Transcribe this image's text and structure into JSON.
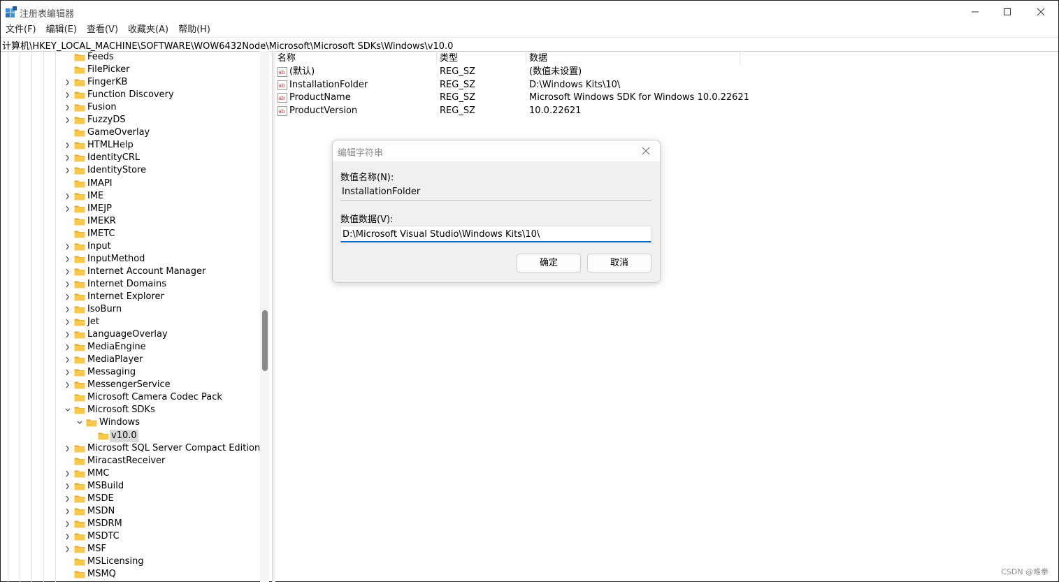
{
  "window": {
    "title": "注册表编辑器"
  },
  "menu": [
    "文件(F)",
    "编辑(E)",
    "查看(V)",
    "收藏夹(A)",
    "帮助(H)"
  ],
  "address": "计算机\\HKEY_LOCAL_MACHINE\\SOFTWARE\\WOW6432Node\\Microsoft\\Microsoft SDKs\\Windows\\v10.0",
  "tree": {
    "items": [
      {
        "label": "Feeds",
        "expander": "none",
        "level": 1
      },
      {
        "label": "FilePicker",
        "expander": "none",
        "level": 1
      },
      {
        "label": "FingerKB",
        "expander": "collapsed",
        "level": 1
      },
      {
        "label": "Function Discovery",
        "expander": "collapsed",
        "level": 1
      },
      {
        "label": "Fusion",
        "expander": "collapsed",
        "level": 1
      },
      {
        "label": "FuzzyDS",
        "expander": "collapsed",
        "level": 1
      },
      {
        "label": "GameOverlay",
        "expander": "none",
        "level": 1
      },
      {
        "label": "HTMLHelp",
        "expander": "collapsed",
        "level": 1
      },
      {
        "label": "IdentityCRL",
        "expander": "collapsed",
        "level": 1
      },
      {
        "label": "IdentityStore",
        "expander": "collapsed",
        "level": 1
      },
      {
        "label": "IMAPI",
        "expander": "none",
        "level": 1
      },
      {
        "label": "IME",
        "expander": "collapsed",
        "level": 1
      },
      {
        "label": "IMEJP",
        "expander": "collapsed",
        "level": 1
      },
      {
        "label": "IMEKR",
        "expander": "none",
        "level": 1
      },
      {
        "label": "IMETC",
        "expander": "none",
        "level": 1
      },
      {
        "label": "Input",
        "expander": "collapsed",
        "level": 1
      },
      {
        "label": "InputMethod",
        "expander": "collapsed",
        "level": 1
      },
      {
        "label": "Internet Account Manager",
        "expander": "collapsed",
        "level": 1
      },
      {
        "label": "Internet Domains",
        "expander": "collapsed",
        "level": 1
      },
      {
        "label": "Internet Explorer",
        "expander": "collapsed",
        "level": 1
      },
      {
        "label": "IsoBurn",
        "expander": "collapsed",
        "level": 1
      },
      {
        "label": "Jet",
        "expander": "collapsed",
        "level": 1
      },
      {
        "label": "LanguageOverlay",
        "expander": "collapsed",
        "level": 1
      },
      {
        "label": "MediaEngine",
        "expander": "collapsed",
        "level": 1
      },
      {
        "label": "MediaPlayer",
        "expander": "collapsed",
        "level": 1
      },
      {
        "label": "Messaging",
        "expander": "collapsed",
        "level": 1
      },
      {
        "label": "MessengerService",
        "expander": "collapsed",
        "level": 1
      },
      {
        "label": "Microsoft Camera Codec Pack",
        "expander": "none",
        "level": 1
      },
      {
        "label": "Microsoft SDKs",
        "expander": "expanded",
        "level": 1
      },
      {
        "label": "Windows",
        "expander": "expanded",
        "level": 2
      },
      {
        "label": "v10.0",
        "expander": "none",
        "level": 3,
        "selected": true
      },
      {
        "label": "Microsoft SQL Server Compact Edition",
        "expander": "collapsed",
        "level": 1
      },
      {
        "label": "MiracastReceiver",
        "expander": "none",
        "level": 1
      },
      {
        "label": "MMC",
        "expander": "collapsed",
        "level": 1
      },
      {
        "label": "MSBuild",
        "expander": "collapsed",
        "level": 1
      },
      {
        "label": "MSDE",
        "expander": "collapsed",
        "level": 1
      },
      {
        "label": "MSDN",
        "expander": "collapsed",
        "level": 1
      },
      {
        "label": "MSDRM",
        "expander": "collapsed",
        "level": 1
      },
      {
        "label": "MSDTC",
        "expander": "collapsed",
        "level": 1
      },
      {
        "label": "MSF",
        "expander": "collapsed",
        "level": 1
      },
      {
        "label": "MSLicensing",
        "expander": "none",
        "level": 1
      },
      {
        "label": "MSMQ",
        "expander": "none",
        "level": 1
      }
    ]
  },
  "values": {
    "headers": [
      "名称",
      "类型",
      "数据"
    ],
    "rows": [
      {
        "name": "(默认)",
        "type": "REG_SZ",
        "data": "(数值未设置)"
      },
      {
        "name": "InstallationFolder",
        "type": "REG_SZ",
        "data": "D:\\Windows Kits\\10\\"
      },
      {
        "name": "ProductName",
        "type": "REG_SZ",
        "data": "Microsoft Windows SDK for Windows 10.0.22621"
      },
      {
        "name": "ProductVersion",
        "type": "REG_SZ",
        "data": "10.0.22621"
      }
    ]
  },
  "dialog": {
    "title": "编辑字符串",
    "name_label": "数值名称(N):",
    "name_value": "InstallationFolder",
    "data_label": "数值数据(V):",
    "data_value": "D:\\Microsoft Visual Studio\\Windows Kits\\10\\",
    "ok": "确定",
    "cancel": "取消"
  },
  "watermark": "CSDN @难拳",
  "colors": {
    "folder": "#f8c84a",
    "folder_dark": "#e0a82c",
    "accent": "#0067c0",
    "ab_icon": "#c43b3b",
    "selection": "#d9d9d9"
  }
}
